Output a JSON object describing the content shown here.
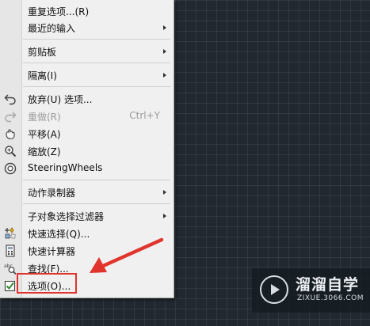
{
  "context_menu": {
    "items": {
      "repeat_options": {
        "label": "重复选项...(R)"
      },
      "recent_input": {
        "label": "最近的输入"
      },
      "clipboard": {
        "label": "剪贴板"
      },
      "isolate": {
        "label": "隔离(I)"
      },
      "undo": {
        "label": "放弃(U) 选项..."
      },
      "redo": {
        "label": "重做(R)",
        "shortcut": "Ctrl+Y"
      },
      "pan": {
        "label": "平移(A)"
      },
      "zoom": {
        "label": "缩放(Z)"
      },
      "steering_wheels": {
        "label": "SteeringWheels"
      },
      "action_recorder": {
        "label": "动作录制器"
      },
      "subobject_filter": {
        "label": "子对象选择过滤器"
      },
      "quick_select": {
        "label": "快速选择(Q)..."
      },
      "quick_calc": {
        "label": "快速计算器"
      },
      "find": {
        "label": "查找(F)..."
      },
      "options": {
        "label": "选项(O)..."
      }
    }
  },
  "watermark": {
    "title": "溜溜自学",
    "url": "ZIXUE.3066.COM"
  },
  "colors": {
    "canvas_background": "#212830",
    "menu_background": "#f0f0f0",
    "annotation_red": "#e0342d"
  }
}
